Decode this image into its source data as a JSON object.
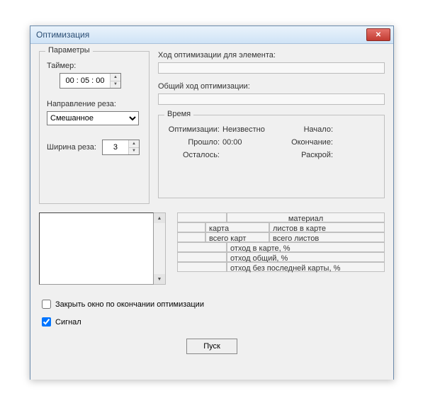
{
  "window": {
    "title": "Оптимизация"
  },
  "params": {
    "group_title": "Параметры",
    "timer_label": "Таймер:",
    "timer_value": "00 : 05 : 00",
    "direction_label": "Направление реза:",
    "direction_value": "Смешанное",
    "width_label": "Ширина реза:",
    "width_value": "3"
  },
  "progress": {
    "element_label": "Ход оптимизации для элемента:",
    "overall_label": "Общий ход оптимизации:"
  },
  "time": {
    "group_title": "Время",
    "opt_label": "Оптимизации:",
    "opt_value": "Неизвестно",
    "start_label": "Начало:",
    "elapsed_label": "Прошло:",
    "elapsed_value": "00:00",
    "end_label": "Окончание:",
    "remain_label": "Осталось:",
    "cutting_label": "Раскрой:"
  },
  "table": {
    "material": "материал",
    "card": "карта",
    "sheets_in_card": "листов в карте",
    "total_cards": "всего карт",
    "total_sheets": "всего листов",
    "waste_card": "отход в карте, %",
    "waste_total": "отход общий, %",
    "waste_no_last": "отход без последней карты, %"
  },
  "checks": {
    "close_label": "Закрыть окно по окончании оптимизации",
    "signal_label": "Сигнал"
  },
  "buttons": {
    "run": "Пуск"
  }
}
